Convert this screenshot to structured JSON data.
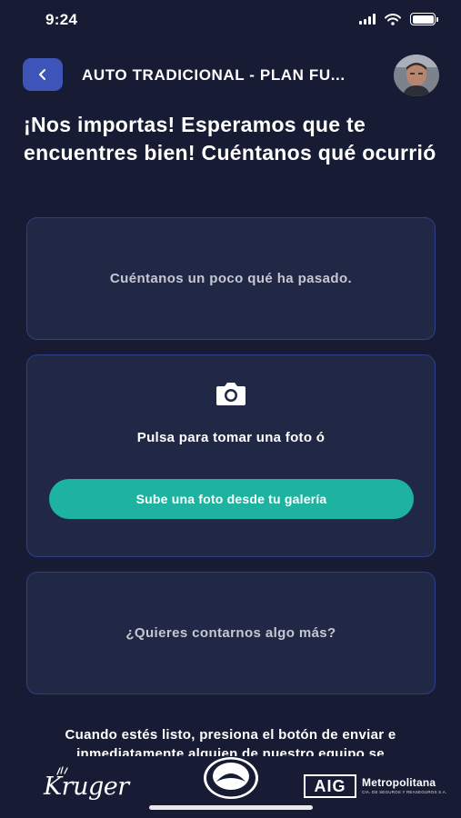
{
  "status_bar": {
    "time": "9:24",
    "icons": [
      "signal-icon",
      "wifi-icon",
      "battery-icon"
    ]
  },
  "header": {
    "back_icon": "chevron-left-icon",
    "title": "AUTO TRADICIONAL - PLAN FU...",
    "avatar": "user-avatar"
  },
  "headline": "¡Nos importas! Esperamos que te encuentres bien! Cuéntanos qué ocurrió",
  "describe_card": {
    "placeholder": "Cuéntanos un poco qué ha pasado."
  },
  "photo_card": {
    "icon": "camera-icon",
    "prompt": "Pulsa para tomar una foto ó",
    "gallery_button": "Sube una foto desde tu galería"
  },
  "more_card": {
    "placeholder": "¿Quieres contarnos algo más?"
  },
  "instruction": "Cuando estés listo, presiona el botón de enviar e inmediatamente alguien de nuestro equipo se",
  "footer": {
    "logo_kruger": "Kruger",
    "logo_aig": "AIG",
    "logo_metropolitana": "Metropolitana",
    "logo_metropolitana_sub": "CIA. DE SEGUROS Y REASEGUROS S.A."
  },
  "colors": {
    "background": "#171c34",
    "card": "#212845",
    "card_border": "#2d3f86",
    "accent_blue": "#3d54b8",
    "accent_teal": "#1eb3a0"
  }
}
